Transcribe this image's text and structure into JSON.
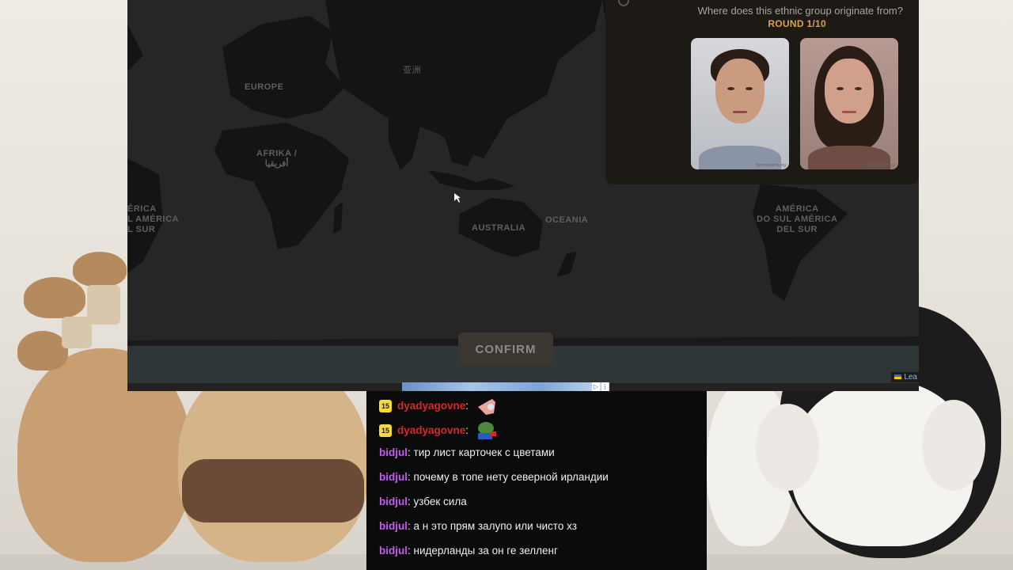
{
  "game": {
    "question": "Where does this ethnic group originate from?",
    "round": "ROUND 1/10",
    "confirm_label": "CONFIRM",
    "attribution": "Lea",
    "map_labels": {
      "europe": "EUROPE",
      "asia": "亚洲",
      "africa": "AFRIKA /\nأفريقيا",
      "australia": "AUSTRALIA",
      "oceania": "OCEANIA",
      "south_america_left": "ÉRICA\nL AMÉRICA\nL SUR",
      "south_america_right": "AMÉRICA\nDO SUL AMÉRICA\nDEL SUR"
    },
    "portraits": [
      {
        "label": "male composite portrait",
        "watermark": "faceresearch.org"
      },
      {
        "label": "female composite portrait",
        "watermark": "faceresearch.org"
      }
    ]
  },
  "chat": {
    "messages": [
      {
        "badge": "15",
        "user": "dyadyagovne",
        "text": "",
        "emote": "pointing-emote",
        "color": "#d42a2a"
      },
      {
        "badge": "15",
        "user": "dyadyagovne",
        "text": "",
        "emote": "pepe-emote",
        "color": "#d42a2a"
      },
      {
        "badge": "",
        "user": "bidjul",
        "text": "тир лист карточек с цветами",
        "color": "#c45cf2"
      },
      {
        "badge": "",
        "user": "bidjul",
        "text": "почему в топе нету северной ирландии",
        "color": "#c45cf2"
      },
      {
        "badge": "",
        "user": "bidjul",
        "text": "узбек сила",
        "color": "#c45cf2"
      },
      {
        "badge": "",
        "user": "bidjul",
        "text": "а н это прям залупо или чисто хз",
        "color": "#c45cf2"
      },
      {
        "badge": "",
        "user": "bidjul",
        "text": "нидерланды за он ге зелленг",
        "color": "#c45cf2"
      }
    ]
  }
}
